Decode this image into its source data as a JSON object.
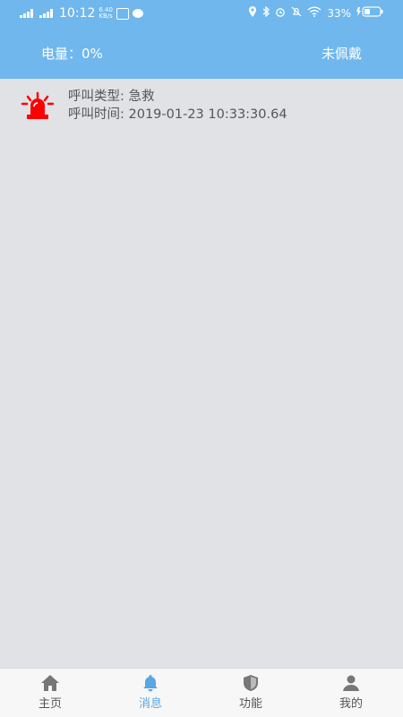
{
  "status_bar": {
    "network_1": "4G",
    "network_2": "4G",
    "time": "10:12",
    "speed_value": "6.40",
    "speed_unit": "KB/s",
    "battery_percent": "33%"
  },
  "header": {
    "battery_label": "电量：",
    "battery_value": "0%",
    "wear_status": "未佩戴"
  },
  "messages": [
    {
      "icon": "alarm-icon",
      "type_label": "呼叫类型:",
      "type_value": "急救",
      "time_label": "呼叫时间:",
      "time_value": "2019-01-23 10:33:30.64"
    }
  ],
  "tabs": [
    {
      "label": "主页",
      "icon": "home-icon"
    },
    {
      "label": "消息",
      "icon": "bell-icon"
    },
    {
      "label": "功能",
      "icon": "shield-icon"
    },
    {
      "label": "我的",
      "icon": "person-icon"
    }
  ],
  "colors": {
    "accent": "#6fb7ec",
    "active_tab": "#56a7e4",
    "alarm": "#ff0000",
    "background": "#e1e2e6"
  }
}
